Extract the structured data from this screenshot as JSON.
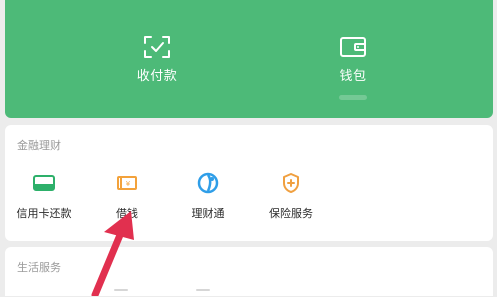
{
  "top_actions": [
    {
      "label": "收付款",
      "icon": "scan-pay-icon"
    },
    {
      "label": "钱包",
      "icon": "wallet-icon"
    }
  ],
  "finance": {
    "title": "金融理财",
    "items": [
      {
        "label": "信用卡还款",
        "icon": "credit-card-icon",
        "color": "#2db06a"
      },
      {
        "label": "借钱",
        "icon": "loan-icon",
        "color": "#f3a23b"
      },
      {
        "label": "理财通",
        "icon": "licaitong-icon",
        "color": "#2f9ee8"
      },
      {
        "label": "保险服务",
        "icon": "insurance-icon",
        "color": "#f0a040"
      }
    ]
  },
  "life": {
    "title": "生活服务"
  },
  "colors": {
    "green": "#4dba78",
    "arrow": "#e1304f",
    "bg": "#ececec"
  }
}
